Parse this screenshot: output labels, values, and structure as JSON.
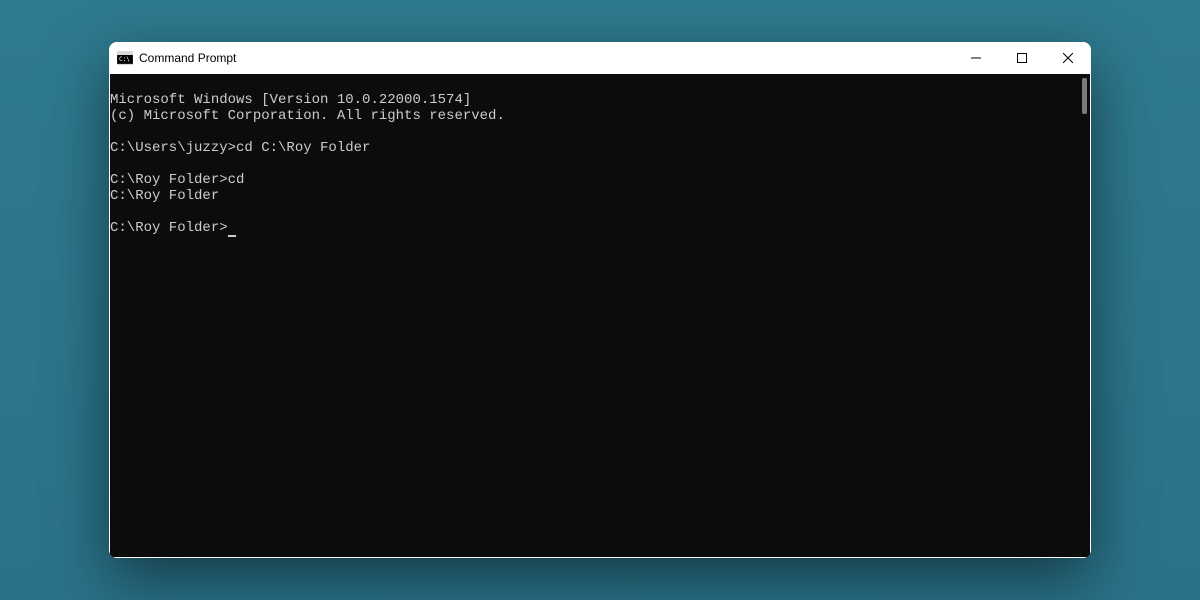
{
  "window": {
    "title": "Command Prompt"
  },
  "terminal": {
    "lines": [
      "Microsoft Windows [Version 10.0.22000.1574]",
      "(c) Microsoft Corporation. All rights reserved.",
      "",
      "C:\\Users\\juzzy>cd C:\\Roy Folder",
      "",
      "C:\\Roy Folder>cd",
      "C:\\Roy Folder",
      "",
      "C:\\Roy Folder>"
    ]
  }
}
